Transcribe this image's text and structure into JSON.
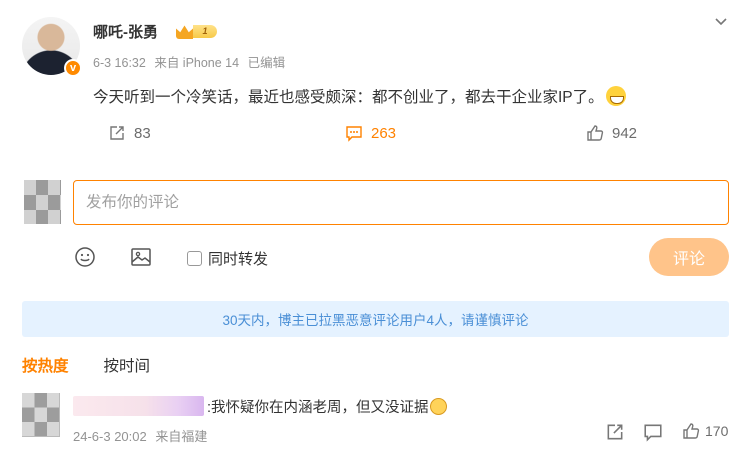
{
  "post": {
    "author": "哪吒-张勇",
    "level": "1",
    "verified_mark": "v",
    "date": "6-3 16:32",
    "source": "来自 iPhone 14",
    "edited": "已编辑",
    "text": "今天听到一个冷笑话，最近也感受颇深：都不创业了，都去干企业家IP了。",
    "emoji": "grin-icon"
  },
  "actions": {
    "repost_count": "83",
    "comment_count": "263",
    "like_count": "942"
  },
  "composer": {
    "placeholder": "发布你的评论",
    "repost_label": "同时转发",
    "submit_label": "评论"
  },
  "notice": "30天内，博主已拉黑恶意评论用户4人，请谨慎评论",
  "sort_tabs": [
    "按热度",
    "按时间"
  ],
  "comment": {
    "text": ":我怀疑你在内涵老周，但又没证据",
    "date": "24-6-3 20:02",
    "location": "来自福建",
    "like_count": "170"
  },
  "colors": {
    "accent": "#ff8200",
    "notice_bg": "#e5f2ff",
    "notice_text": "#4a8fd6",
    "submit_disabled": "#ffc48a"
  }
}
